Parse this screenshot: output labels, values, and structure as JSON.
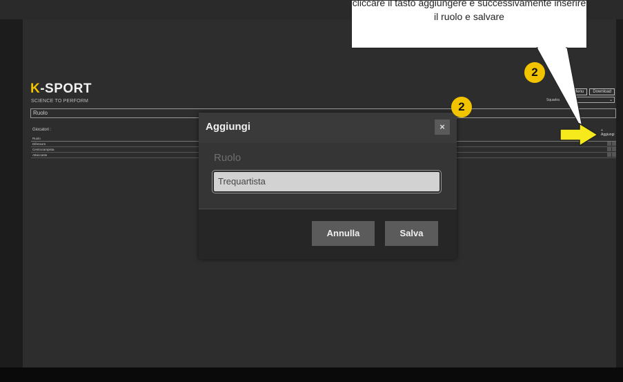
{
  "app": {
    "logo_text": "K-SPORT",
    "tagline": "SCIENCE TO PERFORM",
    "nav_menu": "Menu",
    "nav_download": "Download",
    "squadra_label": "Squadra",
    "squadra_value": "",
    "page_title": "Ruolo",
    "section_title": "Giocatori :",
    "add_link": "+ Aggiungi",
    "table": {
      "header": "Ruolo",
      "rows": [
        "Difensore",
        "Centrocampista",
        "Attaccante"
      ]
    }
  },
  "modal": {
    "title": "Aggiungi",
    "close_symbol": "×",
    "field_label": "Ruolo",
    "field_value": "Trequartista",
    "cancel_label": "Annulla",
    "save_label": "Salva"
  },
  "annotations": {
    "callout_text": "cliccare il tasto aggiungere e successivamente inserire il ruolo e salvare",
    "badge_a": "2",
    "badge_b": "2"
  },
  "colors": {
    "accent": "#f2c400",
    "background": "#2d2d2d",
    "modal_bg": "#353535",
    "button_bg": "#5b5b5b"
  }
}
